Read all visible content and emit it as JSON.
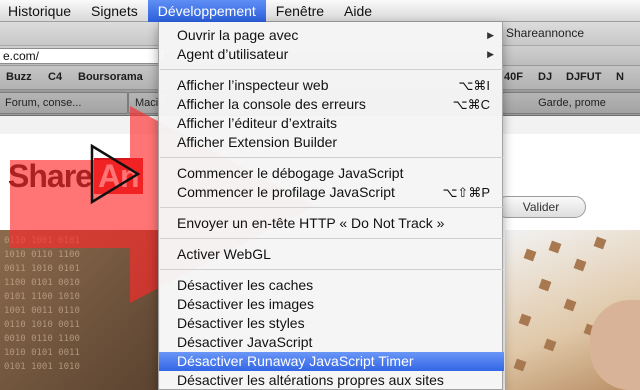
{
  "menubar": {
    "items": [
      "Historique",
      "Signets",
      "Développement",
      "Fenêtre",
      "Aide"
    ],
    "active_index": 2
  },
  "window": {
    "title_fragment": "Shareannonce"
  },
  "urlbar": {
    "value": "e.com/"
  },
  "bookmarks": [
    "Buzz",
    "C4",
    "Boursorama",
    "40F",
    "DJ",
    "DJFUT",
    "N"
  ],
  "tabs": [
    "Forum, conse...",
    "Maci",
    "Garde, prome"
  ],
  "page": {
    "logo_left": "Share",
    "logo_right": "An",
    "validate_button": "Valider",
    "bits": "0110 1001 0101\n1010 0110 1100\n0011 1010 0101\n1100 0101 0010\n0101 1100 1010\n1001 0011 0110\n0110 1010 0011\n0010 0110 1100\n1010 0101 0011\n0101 1001 1010"
  },
  "menu": {
    "items": [
      {
        "label": "Ouvrir la page avec",
        "submenu": true
      },
      {
        "label": "Agent d’utilisateur",
        "submenu": true
      },
      {
        "label": "Afficher l’inspecteur web",
        "shortcut": "⌥⌘I"
      },
      {
        "label": "Afficher la console des erreurs",
        "shortcut": "⌥⌘C"
      },
      {
        "label": "Afficher l’éditeur d’extraits"
      },
      {
        "label": "Afficher Extension Builder"
      },
      {
        "label": "Commencer le débogage JavaScript"
      },
      {
        "label": "Commencer le profilage JavaScript",
        "shortcut": "⌥⇧⌘P"
      },
      {
        "label": "Envoyer un en-tête HTTP « Do Not Track »"
      },
      {
        "label": "Activer WebGL"
      },
      {
        "label": "Désactiver les caches"
      },
      {
        "label": "Désactiver les images"
      },
      {
        "label": "Désactiver les styles"
      },
      {
        "label": "Désactiver JavaScript"
      },
      {
        "label": "Désactiver Runaway JavaScript Timer",
        "highlighted": true
      },
      {
        "label": "Désactiver les altérations propres aux sites"
      }
    ]
  },
  "colors": {
    "menu_highlight": "#3366e6",
    "logo_red": "#d8161c",
    "arrow_red": "#ff2a2a"
  }
}
